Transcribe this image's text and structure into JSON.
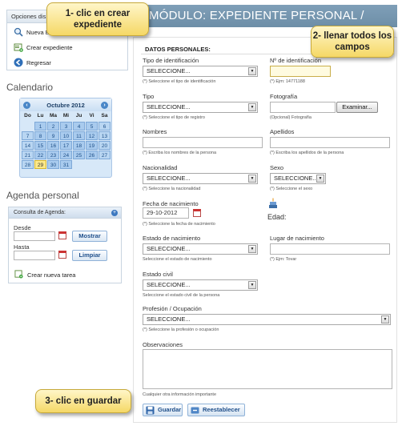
{
  "callouts": {
    "c1": "1- clic en crear expediente",
    "c2": "2- llenar todos los campos",
    "c3": "3- clic en guardar"
  },
  "header": {
    "title": "MÓDULO: EXPEDIENTE PERSONAL / NUEVO"
  },
  "sidebar": {
    "opciones_title": "Opciones dis",
    "items": [
      {
        "label": "Nueva B",
        "icon": "search-icon"
      },
      {
        "label": "Crear expediente",
        "icon": "add-record-icon"
      },
      {
        "label": "Regresar",
        "icon": "back-arrow-icon"
      }
    ],
    "calendario_title": "Calendario",
    "calendar": {
      "month": "Octubre 2012",
      "dows": [
        "Do",
        "Lu",
        "Ma",
        "Mi",
        "Ju",
        "Vi",
        "Sa"
      ],
      "weeks": [
        [
          "",
          "1",
          "2",
          "3",
          "4",
          "5",
          "6"
        ],
        [
          "7",
          "8",
          "9",
          "10",
          "11",
          "12",
          "13"
        ],
        [
          "14",
          "15",
          "16",
          "17",
          "18",
          "19",
          "20"
        ],
        [
          "21",
          "22",
          "23",
          "24",
          "25",
          "26",
          "27"
        ],
        [
          "28",
          "29",
          "30",
          "31",
          "",
          "",
          ""
        ]
      ],
      "today": "29"
    },
    "agenda_title": "Agenda personal",
    "agenda": {
      "header": "Consulta de Agenda:",
      "desde": "Desde",
      "hasta": "Hasta",
      "mostrar": "Mostrar",
      "limpiar": "Limpiar",
      "crear_tarea": "Crear nueva tarea"
    }
  },
  "form": {
    "section_title": "DATOS PERSONALES:",
    "tipo_identificacion": {
      "label": "Tipo de identificación",
      "value": "SELECCIONE...",
      "hint": "(*) Seleccione el tipo de identificación"
    },
    "no_identificacion": {
      "label": "Nº de identificación",
      "value": "",
      "hint": "(*) Ejm: 14771188"
    },
    "tipo": {
      "label": "Tipo",
      "value": "SELECCIONE...",
      "hint": "(*) Seleccione el tipo de registro"
    },
    "fotografia": {
      "label": "Fotografía",
      "button": "Examinar...",
      "hint": "(Opcional) Fotografía"
    },
    "nombres": {
      "label": "Nombres",
      "value": "",
      "hint": "(*) Escriba los nombres de la persona"
    },
    "apellidos": {
      "label": "Apellidos",
      "value": "",
      "hint": "(*) Escriba los apellidos de la persona"
    },
    "nacionalidad": {
      "label": "Nacionalidad",
      "value": "SELECCIONE...",
      "hint": "(*) Seleccione la nacionalidad"
    },
    "sexo": {
      "label": "Sexo",
      "value": "SELECCIONE...",
      "hint": "(*) Seleccione el sexo"
    },
    "fecha_nacimiento": {
      "label": "Fecha de nacimiento",
      "value": "29-10-2012",
      "hint": "(*) Seleccione la fecha de nacimiento"
    },
    "edad": {
      "label": "Edad:"
    },
    "estado_nacimiento": {
      "label": "Estado de nacimiento",
      "value": "SELECCIONE...",
      "hint": "Seleccione el estado de nacimiento"
    },
    "lugar_nacimiento": {
      "label": "Lugar de nacimiento",
      "value": "",
      "hint": "(*) Ejm: Tovar"
    },
    "estado_civil": {
      "label": "Estado civil",
      "value": "SELECCIONE...",
      "hint": "Seleccione el estado civil de la persona"
    },
    "profesion": {
      "label": "Profesión / Ocupación",
      "value": "SELECCIONE...",
      "hint": "(*) Seleccione la profesión o ocupación"
    },
    "observaciones": {
      "label": "Observaciones",
      "value": "",
      "hint": "Cualquier otra información importante"
    },
    "guardar": "Guardar",
    "reestablecer": "Reestablecer"
  }
}
